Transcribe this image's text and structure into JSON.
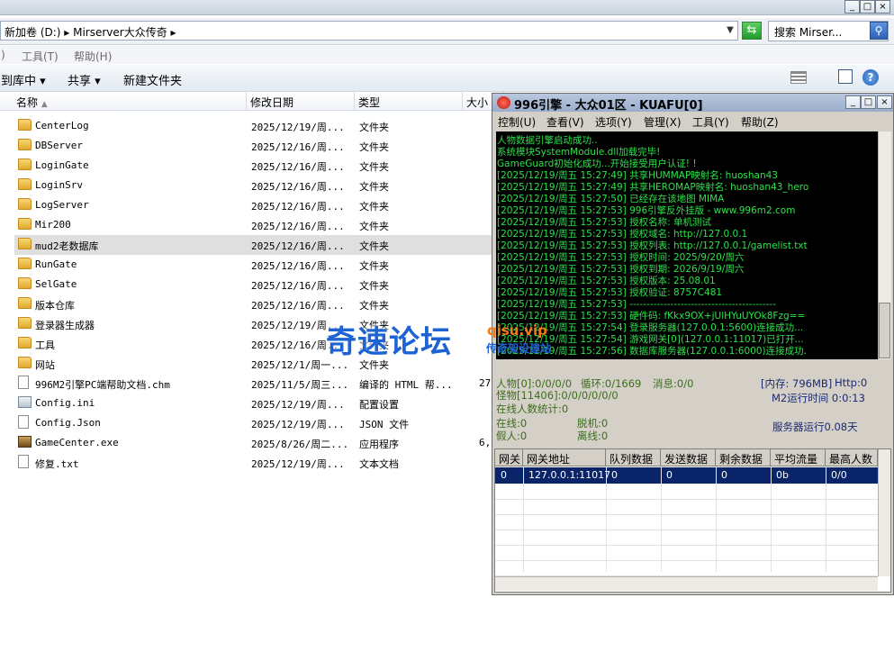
{
  "explorer": {
    "title_buttons": [
      "_",
      "□",
      "×"
    ],
    "address": "新加卷 (D:) ▸ Mirserver大众传奇 ▸",
    "search_placeholder": "搜索 Mirser...",
    "menu": [
      "工具(T)",
      "帮助(H)"
    ],
    "menu_left_fragment": ")",
    "toolbar": {
      "library": "到库中 ▾",
      "share": "共享 ▾",
      "new_folder": "新建文件夹"
    },
    "columns": [
      "名称",
      "修改日期",
      "类型",
      "大小"
    ],
    "files": [
      {
        "name": "CenterLog",
        "date": "2025/12/19/周...",
        "type": "文件夹",
        "size": "",
        "icon": "folder-icon"
      },
      {
        "name": "DBServer",
        "date": "2025/12/16/周...",
        "type": "文件夹",
        "size": "",
        "icon": "folder-icon"
      },
      {
        "name": "LoginGate",
        "date": "2025/12/16/周...",
        "type": "文件夹",
        "size": "",
        "icon": "folder-icon"
      },
      {
        "name": "LoginSrv",
        "date": "2025/12/16/周...",
        "type": "文件夹",
        "size": "",
        "icon": "folder-icon"
      },
      {
        "name": "LogServer",
        "date": "2025/12/16/周...",
        "type": "文件夹",
        "size": "",
        "icon": "folder-icon"
      },
      {
        "name": "Mir200",
        "date": "2025/12/16/周...",
        "type": "文件夹",
        "size": "",
        "icon": "folder-icon"
      },
      {
        "name": "mud2老数据库",
        "date": "2025/12/16/周...",
        "type": "文件夹",
        "size": "",
        "icon": "folder-icon",
        "selected": true
      },
      {
        "name": "RunGate",
        "date": "2025/12/16/周...",
        "type": "文件夹",
        "size": "",
        "icon": "folder-icon"
      },
      {
        "name": "SelGate",
        "date": "2025/12/16/周...",
        "type": "文件夹",
        "size": "",
        "icon": "folder-icon"
      },
      {
        "name": "版本仓库",
        "date": "2025/12/16/周...",
        "type": "文件夹",
        "size": "",
        "icon": "folder-icon"
      },
      {
        "name": "登录器生成器",
        "date": "2025/12/19/周...",
        "type": "文件夹",
        "size": "",
        "icon": "folder-icon"
      },
      {
        "name": "工具",
        "date": "2025/12/16/周...",
        "type": "文件夹",
        "size": "",
        "icon": "folder-icon"
      },
      {
        "name": "网站",
        "date": "2025/12/1/周一...",
        "type": "文件夹",
        "size": "",
        "icon": "folder-icon"
      },
      {
        "name": "996M2引擎PC端帮助文档.chm",
        "date": "2025/11/5/周三...",
        "type": "编译的 HTML 帮...",
        "size": "27,",
        "icon": "chm-file-icon"
      },
      {
        "name": "Config.ini",
        "date": "2025/12/19/周...",
        "type": "配置设置",
        "size": "",
        "icon": "config-file-icon"
      },
      {
        "name": "Config.Json",
        "date": "2025/12/19/周...",
        "type": "JSON 文件",
        "size": "",
        "icon": "text-file-icon"
      },
      {
        "name": "GameCenter.exe",
        "date": "2025/8/26/周二...",
        "type": "应用程序",
        "size": "6,",
        "icon": "exe-file-icon"
      },
      {
        "name": "修复.txt",
        "date": "2025/12/19/周...",
        "type": "文本文档",
        "size": "",
        "icon": "text-file-icon"
      }
    ]
  },
  "engine": {
    "title": "996引擎 - 大众01区 - KUAFU[0]",
    "title_buttons": [
      "_",
      "□",
      "×"
    ],
    "menu": [
      "控制(U)",
      "查看(V)",
      "选项(Y)",
      "管理(X)",
      "工具(Y)",
      "帮助(Z)"
    ],
    "console_lines": [
      "人物数据引擎启动成功..",
      "系统模块SystemModule.dll加载完毕!",
      "GameGuard初始化成功...开始接受用户认证! !",
      "[2025/12/19/周五 15:27:49] 共享HUMMAP映射名: huoshan43",
      "[2025/12/19/周五 15:27:49] 共享HEROMAP映射名: huoshan43_hero",
      "[2025/12/19/周五 15:27:50] 已经存在该地图 MIMA",
      "[2025/12/19/周五 15:27:53] 996引擎反外挂版 - www.996m2.com",
      "[2025/12/19/周五 15:27:53] 授权名称: 单机测试",
      "[2025/12/19/周五 15:27:53] 授权域名: http://127.0.0.1",
      "[2025/12/19/周五 15:27:53] 授权列表: http://127.0.0.1/gamelist.txt",
      "[2025/12/19/周五 15:27:53] 授权时间: 2025/9/20/周六",
      "[2025/12/19/周五 15:27:53] 授权到期: 2026/9/19/周六",
      "[2025/12/19/周五 15:27:53] 授权版本: 25.08.01",
      "[2025/12/19/周五 15:27:53] 授权验证: 8757C481",
      "[2025/12/19/周五 15:27:53] -------------------------------------------",
      "[2025/12/19/周五 15:27:53] 硬件码: fKkx9OX+jUlHYuUYOk8Fzg==",
      "[2025/12/19/周五 15:27:54] 登录服务器(127.0.0.1:5600)连接成功...",
      "[2025/12/19/周五 15:27:54] 游戏网关[0](127.0.0.1:11017)已打开...",
      "[2025/12/19/周五 15:27:56] 数据库服务器(127.0.0.1:6000)连接成功."
    ],
    "stats": {
      "people": "人物[0]:0/0/0/0",
      "loop": "循环:0/1669",
      "msg": "消息:0/0",
      "memory": "[内存: 796MB]",
      "http": "Http:0",
      "monsters": "怪物[11406]:0/0/0/0/0/0",
      "m2_runtime": "M2运行时间 0:0:13",
      "online_stats": "在线人数统计:0",
      "online": "在线:0",
      "offline": "脱机:0",
      "fake": "假人:0",
      "left": "离线:0",
      "server_runtime": "服务器运行0.08天"
    },
    "gateway_columns": [
      "网关",
      "网关地址",
      "队列数据",
      "发送数据",
      "剩余数据",
      "平均流量",
      "最高人数"
    ],
    "gateway_rows": [
      [
        "0",
        "127.0.0.1:11017",
        "0",
        "0",
        "0",
        "0b",
        "0/0"
      ]
    ]
  },
  "watermark": {
    "main": "奇速论坛",
    "site": "qisu.vip",
    "sub": "传奇架设建站"
  }
}
